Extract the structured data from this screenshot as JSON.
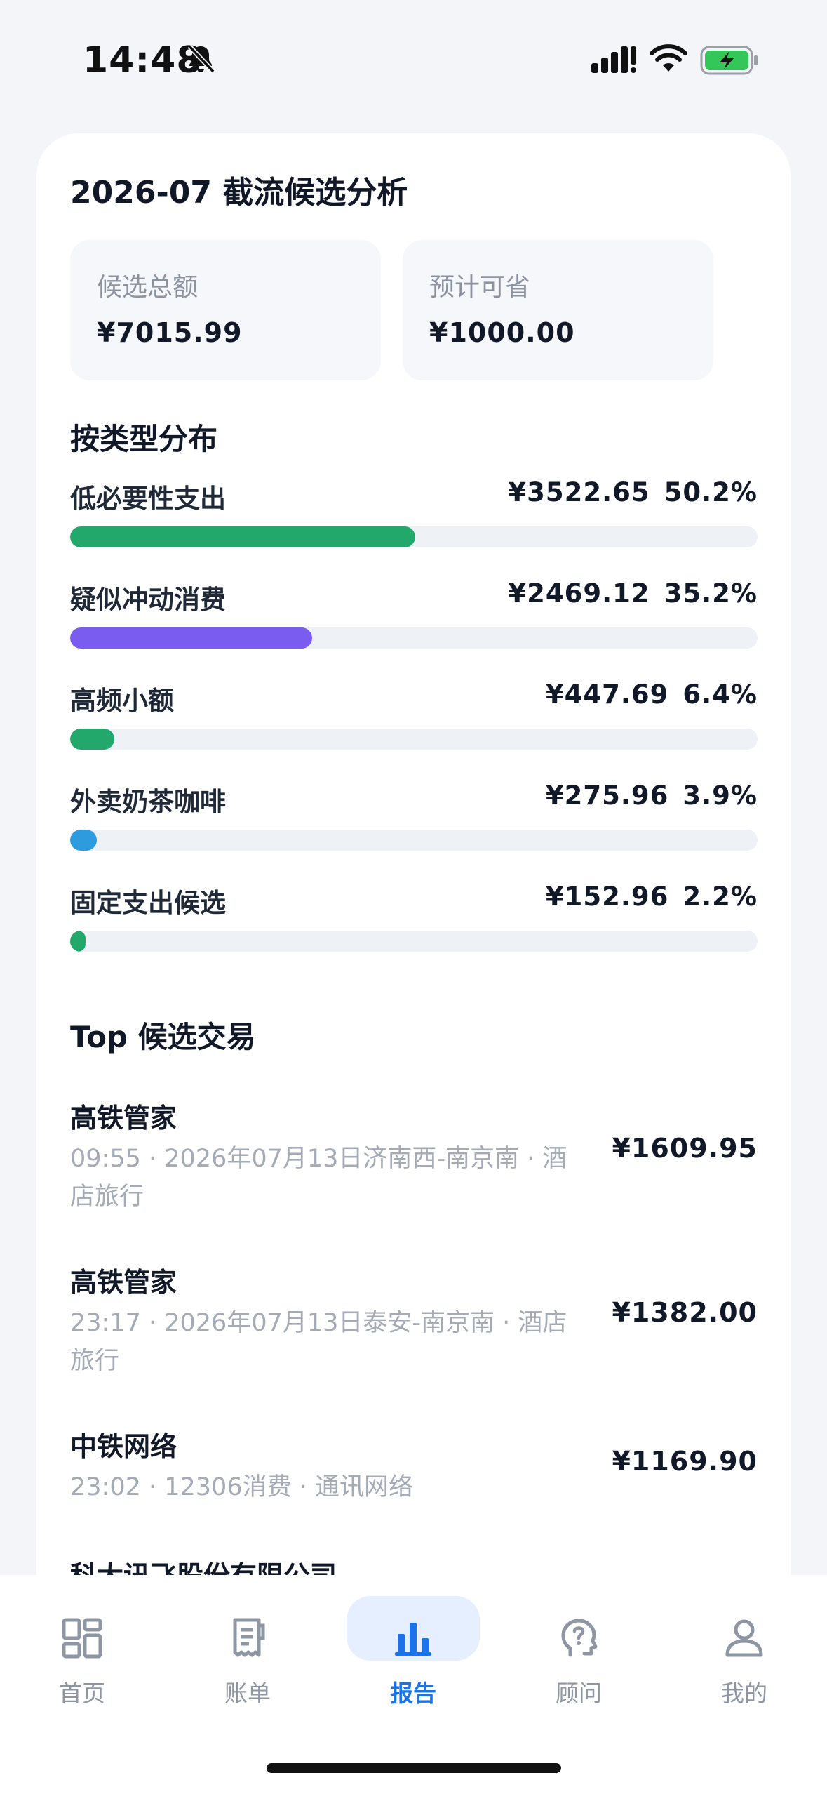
{
  "status_bar": {
    "time": "14:48"
  },
  "card": {
    "title": "2026-07 截流候选分析",
    "stats": [
      {
        "label": "候选总额",
        "value": "¥7015.99"
      },
      {
        "label": "预计可省",
        "value": "¥1000.00"
      }
    ]
  },
  "distribution": {
    "title": "按类型分布",
    "items": [
      {
        "name": "低必要性支出",
        "amount": "¥3522.65",
        "percent": "50.2%",
        "share": 0.502,
        "color": "#22a86b"
      },
      {
        "name": "疑似冲动消费",
        "amount": "¥2469.12",
        "percent": "35.2%",
        "share": 0.352,
        "color": "#7b5cf0"
      },
      {
        "name": "高频小额",
        "amount": "¥447.69",
        "percent": "6.4%",
        "share": 0.064,
        "color": "#22a86b"
      },
      {
        "name": "外卖奶茶咖啡",
        "amount": "¥275.96",
        "percent": "3.9%",
        "share": 0.039,
        "color": "#2f9bdf"
      },
      {
        "name": "固定支出候选",
        "amount": "¥152.96",
        "percent": "2.2%",
        "share": 0.022,
        "color": "#22a86b"
      }
    ]
  },
  "top_transactions": {
    "title": "Top 候选交易",
    "items": [
      {
        "merchant": "高铁管家",
        "meta": "09:55 · 2026年07月13日济南西-南京南 · 酒店旅行",
        "amount": "¥1609.95"
      },
      {
        "merchant": "高铁管家",
        "meta": "23:17 · 2026年07月13日泰安-南京南 · 酒店旅行",
        "amount": "¥1382.00"
      },
      {
        "merchant": "中铁网络",
        "meta": "23:02 · 12306消费 · 通讯网络",
        "amount": "¥1169.90"
      },
      {
        "merchant": "科大讯飞股份有限公司",
        "meta": "",
        "amount": ""
      }
    ]
  },
  "tab_bar": {
    "tabs": [
      {
        "label": "首页",
        "icon": "dashboard-icon",
        "active": false
      },
      {
        "label": "账单",
        "icon": "receipt-icon",
        "active": false
      },
      {
        "label": "报告",
        "icon": "bar-chart-icon",
        "active": true
      },
      {
        "label": "顾问",
        "icon": "advisor-head-icon",
        "active": false
      },
      {
        "label": "我的",
        "icon": "user-icon",
        "active": false
      }
    ],
    "active_color": "#1a73e8"
  }
}
